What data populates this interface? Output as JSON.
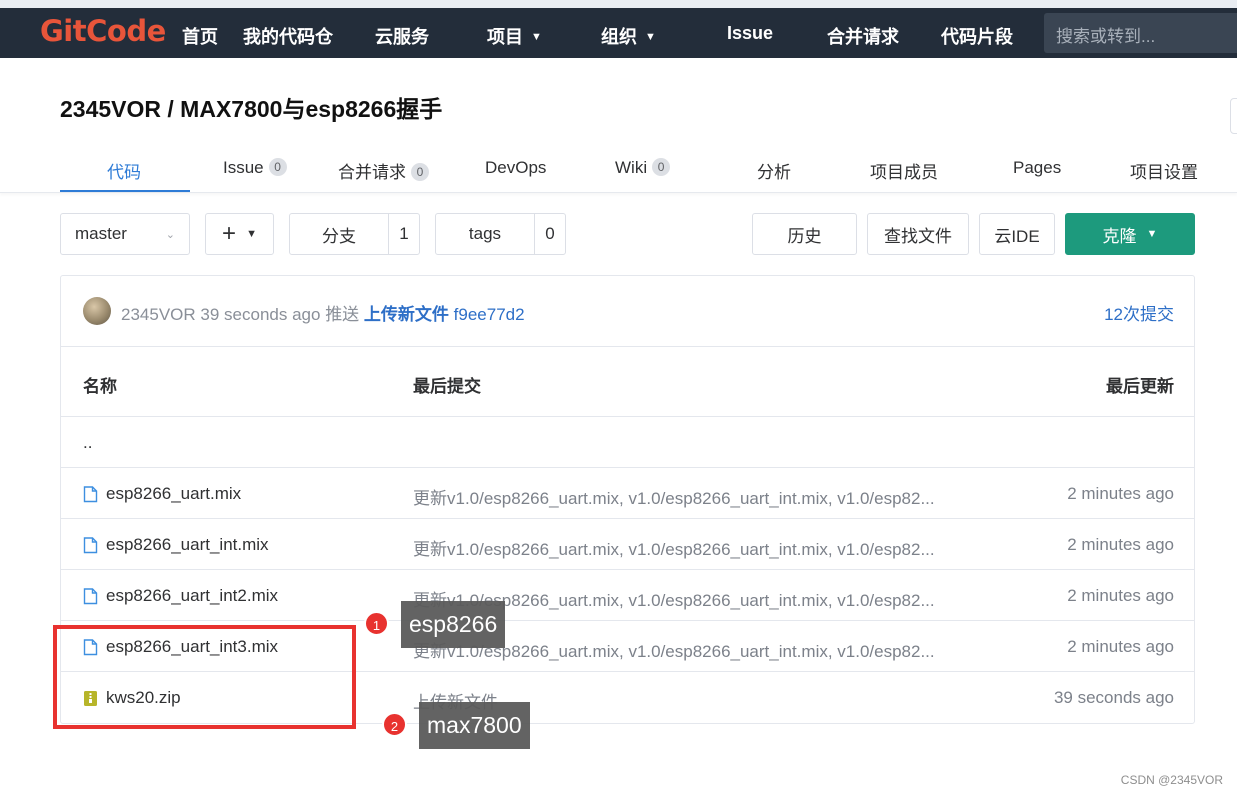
{
  "nav": {
    "logo": "GitCode",
    "items": [
      "首页",
      "我的代码仓",
      "云服务",
      "项目",
      "组织",
      "Issue",
      "合并请求",
      "代码片段"
    ],
    "search_placeholder": "搜索或转到..."
  },
  "repo": {
    "title": "2345VOR / MAX7800与esp8266握手"
  },
  "tabs": [
    {
      "label": "代码"
    },
    {
      "label": "Issue",
      "badge": "0"
    },
    {
      "label": "合并请求",
      "badge": "0"
    },
    {
      "label": "DevOps"
    },
    {
      "label": "Wiki",
      "badge": "0"
    },
    {
      "label": "分析"
    },
    {
      "label": "项目成员"
    },
    {
      "label": "Pages"
    },
    {
      "label": "项目设置"
    }
  ],
  "toolbar": {
    "branch": "master",
    "branches_label": "分支",
    "branches_count": "1",
    "tags_label": "tags",
    "tags_count": "0",
    "history": "历史",
    "find_file": "查找文件",
    "cloud_ide": "云IDE",
    "clone": "克隆"
  },
  "commit": {
    "author": "2345VOR",
    "time": "39 seconds ago",
    "action": "推送",
    "message": "上传新文件",
    "sha": "f9ee77d2",
    "count_label": "12次提交"
  },
  "table": {
    "headers": {
      "name": "名称",
      "last_commit": "最后提交",
      "last_update": "最后更新"
    },
    "parent": "..",
    "rows": [
      {
        "name": "esp8266_uart.mix",
        "icon": "file-icon",
        "commit": "更新v1.0/esp8266_uart.mix, v1.0/esp8266_uart_int.mix, v1.0/esp82...",
        "time": "2 minutes ago"
      },
      {
        "name": "esp8266_uart_int.mix",
        "icon": "file-icon",
        "commit": "更新v1.0/esp8266_uart.mix, v1.0/esp8266_uart_int.mix, v1.0/esp82...",
        "time": "2 minutes ago"
      },
      {
        "name": "esp8266_uart_int2.mix",
        "icon": "file-icon",
        "commit": "更新v1.0/esp8266_uart.mix, v1.0/esp8266_uart_int.mix, v1.0/esp82...",
        "time": "2 minutes ago"
      },
      {
        "name": "esp8266_uart_int3.mix",
        "icon": "file-icon",
        "commit": "更新v1.0/esp8266_uart.mix, v1.0/esp8266_uart_int.mix, v1.0/esp82...",
        "time": "2 minutes ago"
      },
      {
        "name": "kws20.zip",
        "icon": "zip-icon",
        "commit": "上传新文件",
        "time": "39 seconds ago"
      }
    ]
  },
  "annotations": [
    {
      "num": "1",
      "label": "esp8266"
    },
    {
      "num": "2",
      "label": "max7800"
    }
  ],
  "watermark": "CSDN @2345VOR",
  "colors": {
    "nav_bg": "#232d3a",
    "accent": "#2e7bd6",
    "clone": "#1d9a7d",
    "annotation": "#e8322f"
  }
}
